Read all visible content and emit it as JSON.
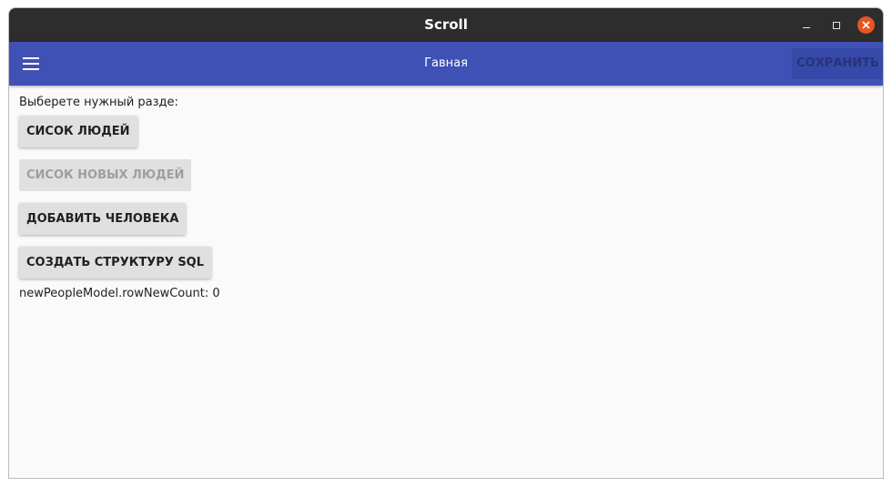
{
  "window": {
    "title": "Scroll"
  },
  "appbar": {
    "title": "Гавная",
    "save_label": "СОХРАНИТЬ"
  },
  "main": {
    "prompt": "Выберете нужный разде:",
    "buttons": [
      {
        "label": "СИСОК ЛЮДЕЙ",
        "enabled": true
      },
      {
        "label": "СИСОК НОВЫХ ЛЮДЕЙ",
        "enabled": false
      },
      {
        "label": "ДОБАВИТЬ ЧЕЛОВЕКА",
        "enabled": true
      },
      {
        "label": "СОЗДАТЬ СТРУКТУРУ SQL",
        "enabled": true
      }
    ],
    "status_text": "newPeopleModel.rowNewCount: 0"
  },
  "colors": {
    "titlebar": "#2d2d2d",
    "appbar": "#3f51b5",
    "close_button": "#e95420",
    "background": "#fafafa",
    "button": "#e0e0e0"
  },
  "icons": {
    "menu": "hamburger-icon",
    "minimize": "minimize-icon",
    "maximize": "maximize-icon",
    "close": "close-icon"
  }
}
